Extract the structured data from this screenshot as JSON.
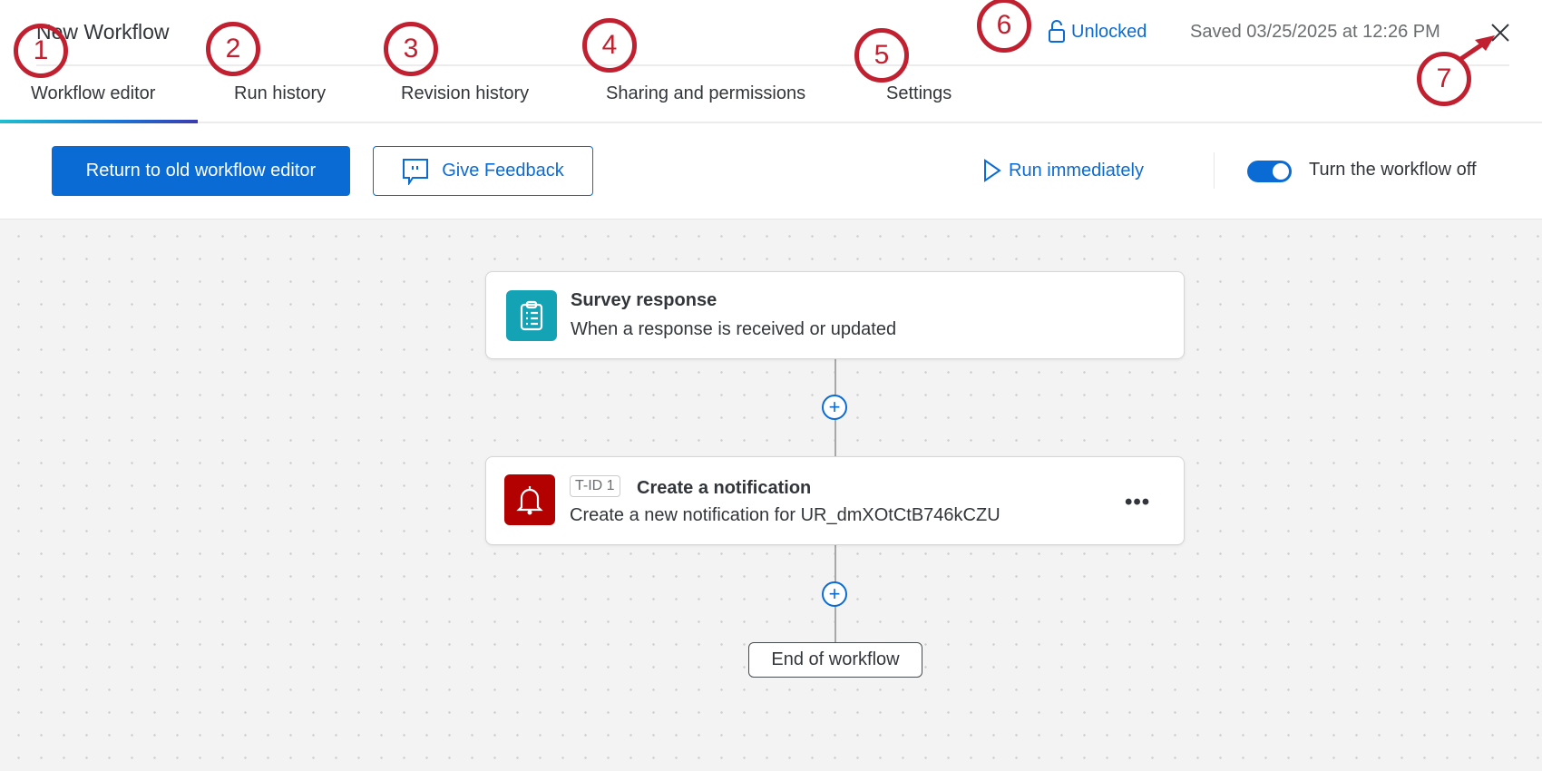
{
  "header": {
    "title": "New Workflow",
    "lock_status": "Unlocked",
    "saved_text": "Saved 03/25/2025 at 12:26 PM"
  },
  "tabs": [
    {
      "label": "Workflow editor",
      "active": true
    },
    {
      "label": "Run history"
    },
    {
      "label": "Revision history"
    },
    {
      "label": "Sharing and permissions"
    },
    {
      "label": "Settings"
    }
  ],
  "toolbar": {
    "return_label": "Return to old workflow editor",
    "feedback_label": "Give Feedback",
    "run_label": "Run immediately",
    "toggle_label": "Turn the workflow off",
    "toggle_on": true
  },
  "workflow": {
    "trigger": {
      "title": "Survey response",
      "subtitle": "When a response is received or updated",
      "icon": "clipboard-icon",
      "color": "#14a3b4"
    },
    "task": {
      "badge": "T-ID 1",
      "title": "Create a notification",
      "subtitle": "Create a new notification for UR_dmXOtCtB746kCZU",
      "icon": "bell-icon",
      "color": "#b30000"
    },
    "end_label": "End of workflow"
  },
  "annotations": [
    "1",
    "2",
    "3",
    "4",
    "5",
    "6",
    "7"
  ],
  "colors": {
    "accent": "#0b6bd4",
    "annotation": "#c0202f"
  }
}
